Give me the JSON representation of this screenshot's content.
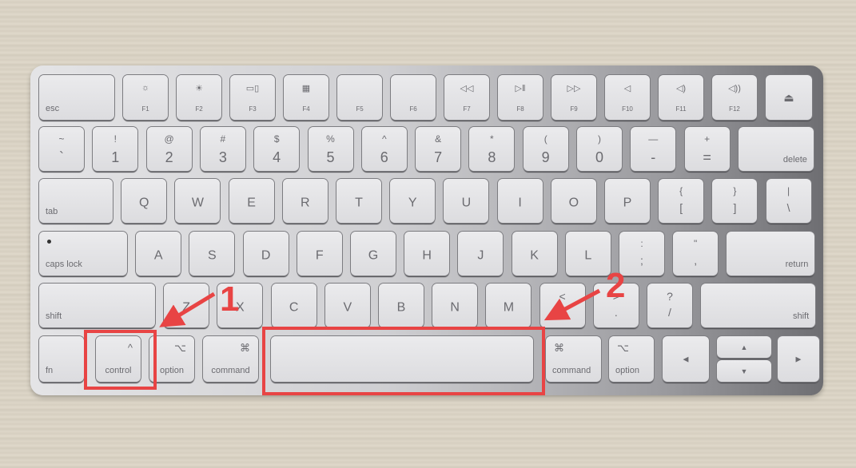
{
  "scene": "Apple Magic Keyboard photographed on a wooden desk with annotations",
  "colors": {
    "annotation": "#e84444",
    "key_face": "#e4e4e6",
    "legend": "#6b6b70"
  },
  "rows": {
    "function": [
      {
        "name": "esc",
        "label": "esc"
      },
      {
        "name": "f1",
        "icon": "☼",
        "label": "F1",
        "icon_name": "brightness-down-icon"
      },
      {
        "name": "f2",
        "icon": "☀",
        "label": "F2",
        "icon_name": "brightness-up-icon"
      },
      {
        "name": "f3",
        "icon": "▭▯",
        "label": "F3",
        "icon_name": "mission-control-icon"
      },
      {
        "name": "f4",
        "icon": "▦",
        "label": "F4",
        "icon_name": "launchpad-icon"
      },
      {
        "name": "f5",
        "icon": "",
        "label": "F5"
      },
      {
        "name": "f6",
        "icon": "",
        "label": "F6"
      },
      {
        "name": "f7",
        "icon": "◁◁",
        "label": "F7",
        "icon_name": "rewind-icon"
      },
      {
        "name": "f8",
        "icon": "▷‖",
        "label": "F8",
        "icon_name": "play-pause-icon"
      },
      {
        "name": "f9",
        "icon": "▷▷",
        "label": "F9",
        "icon_name": "fast-forward-icon"
      },
      {
        "name": "f10",
        "icon": "◁",
        "label": "F10",
        "icon_name": "mute-icon"
      },
      {
        "name": "f11",
        "icon": "◁)",
        "label": "F11",
        "icon_name": "volume-down-icon"
      },
      {
        "name": "f12",
        "icon": "◁))",
        "label": "F12",
        "icon_name": "volume-up-icon"
      },
      {
        "name": "eject",
        "icon": "⏏",
        "label": "",
        "icon_name": "eject-icon"
      }
    ],
    "number": [
      {
        "name": "grave",
        "top": "~",
        "bot": "`"
      },
      {
        "name": "1",
        "top": "!",
        "bot": "1"
      },
      {
        "name": "2",
        "top": "@",
        "bot": "2"
      },
      {
        "name": "3",
        "top": "#",
        "bot": "3"
      },
      {
        "name": "4",
        "top": "$",
        "bot": "4"
      },
      {
        "name": "5",
        "top": "%",
        "bot": "5"
      },
      {
        "name": "6",
        "top": "^",
        "bot": "6"
      },
      {
        "name": "7",
        "top": "&",
        "bot": "7"
      },
      {
        "name": "8",
        "top": "*",
        "bot": "8"
      },
      {
        "name": "9",
        "top": "(",
        "bot": "9"
      },
      {
        "name": "0",
        "top": ")",
        "bot": "0"
      },
      {
        "name": "minus",
        "top": "—",
        "bot": "-"
      },
      {
        "name": "equals",
        "top": "+",
        "bot": "="
      },
      {
        "name": "delete",
        "label": "delete"
      }
    ],
    "qwerty": [
      {
        "name": "tab",
        "label": "tab"
      },
      {
        "name": "q",
        "main": "Q"
      },
      {
        "name": "w",
        "main": "W"
      },
      {
        "name": "e",
        "main": "E"
      },
      {
        "name": "r",
        "main": "R"
      },
      {
        "name": "t",
        "main": "T"
      },
      {
        "name": "y",
        "main": "Y"
      },
      {
        "name": "u",
        "main": "U"
      },
      {
        "name": "i",
        "main": "I"
      },
      {
        "name": "o",
        "main": "O"
      },
      {
        "name": "p",
        "main": "P"
      },
      {
        "name": "lbracket",
        "top": "{",
        "bot": "["
      },
      {
        "name": "rbracket",
        "top": "}",
        "bot": "]"
      },
      {
        "name": "backslash",
        "top": "|",
        "bot": "\\"
      }
    ],
    "home": [
      {
        "name": "caps-lock",
        "label": "caps lock"
      },
      {
        "name": "a",
        "main": "A"
      },
      {
        "name": "s",
        "main": "S"
      },
      {
        "name": "d",
        "main": "D"
      },
      {
        "name": "f",
        "main": "F"
      },
      {
        "name": "g",
        "main": "G"
      },
      {
        "name": "h",
        "main": "H"
      },
      {
        "name": "j",
        "main": "J"
      },
      {
        "name": "k",
        "main": "K"
      },
      {
        "name": "l",
        "main": "L"
      },
      {
        "name": "semicolon",
        "top": ":",
        "bot": ";"
      },
      {
        "name": "quote",
        "top": "\"",
        "bot": ","
      },
      {
        "name": "return",
        "label": "return"
      }
    ],
    "shift": [
      {
        "name": "left-shift",
        "label": "shift"
      },
      {
        "name": "z",
        "main": "Z"
      },
      {
        "name": "x",
        "main": "X"
      },
      {
        "name": "c",
        "main": "C"
      },
      {
        "name": "v",
        "main": "V"
      },
      {
        "name": "b",
        "main": "B"
      },
      {
        "name": "n",
        "main": "N"
      },
      {
        "name": "m",
        "main": "M"
      },
      {
        "name": "comma",
        "top": "<",
        "bot": ","
      },
      {
        "name": "period",
        "top": ">",
        "bot": "."
      },
      {
        "name": "slash",
        "top": "?",
        "bot": "/"
      },
      {
        "name": "right-shift",
        "label": "shift"
      }
    ],
    "bottom": [
      {
        "name": "fn",
        "label": "fn"
      },
      {
        "name": "left-control",
        "symbol": "^",
        "label": "control"
      },
      {
        "name": "left-option",
        "symbol": "⌥",
        "label": "option"
      },
      {
        "name": "left-command",
        "symbol": "⌘",
        "label": "command"
      },
      {
        "name": "space",
        "label": ""
      },
      {
        "name": "right-command",
        "symbol": "⌘",
        "label": "command"
      },
      {
        "name": "right-option",
        "symbol": "⌥",
        "label": "option"
      },
      {
        "name": "arrow-left",
        "symbol": "◀"
      },
      {
        "name": "arrow-up",
        "symbol": "▲"
      },
      {
        "name": "arrow-down",
        "symbol": "▼"
      },
      {
        "name": "arrow-right",
        "symbol": "▶"
      }
    ]
  },
  "annotations": [
    {
      "number": "1",
      "target": "control key"
    },
    {
      "number": "2",
      "target": "space bar"
    }
  ]
}
